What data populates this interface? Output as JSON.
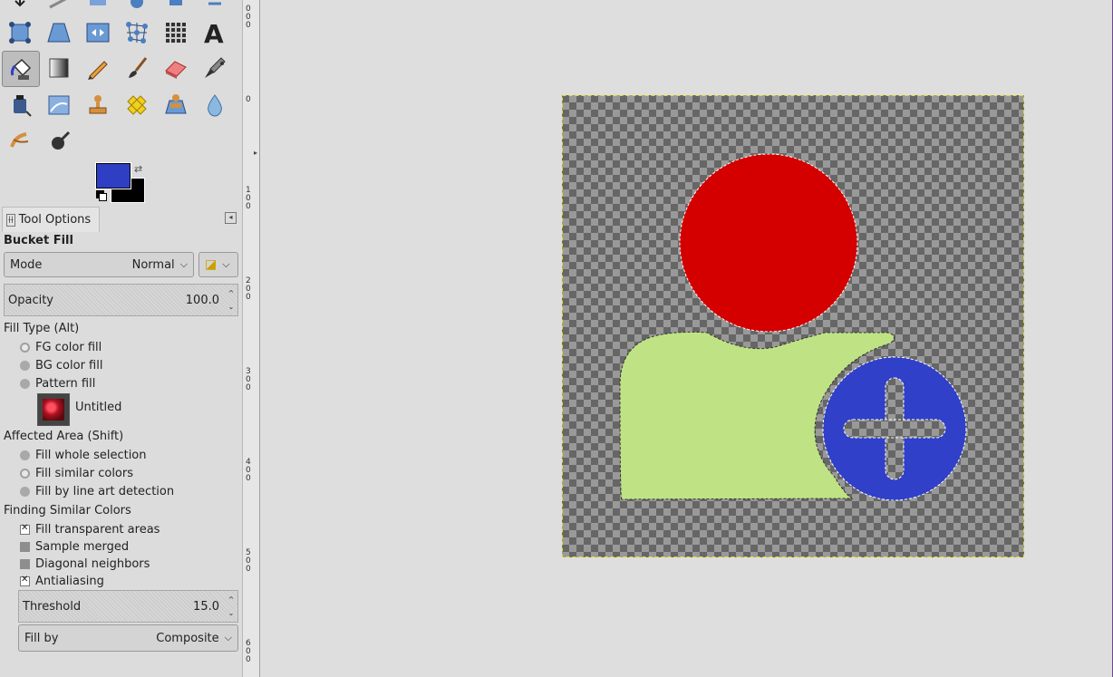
{
  "toolbox": {
    "tools": [
      {
        "icon": "unified-transform-icon"
      },
      {
        "icon": "perspective-icon"
      },
      {
        "icon": "flip-icon"
      },
      {
        "icon": "cage-transform-icon"
      },
      {
        "icon": "warp-transform-icon"
      },
      {
        "icon": "text-icon",
        "glyph": "A"
      },
      {
        "icon": "bucket-fill-icon",
        "active": true
      },
      {
        "icon": "gradient-icon"
      },
      {
        "icon": "pencil-icon"
      },
      {
        "icon": "paintbrush-icon"
      },
      {
        "icon": "eraser-icon"
      },
      {
        "icon": "airbrush-icon"
      },
      {
        "icon": "ink-icon"
      },
      {
        "icon": "mypaint-brush-icon"
      },
      {
        "icon": "clone-icon"
      },
      {
        "icon": "heal-icon"
      },
      {
        "icon": "perspective-clone-icon"
      },
      {
        "icon": "blur-icon"
      },
      {
        "icon": "smudge-icon"
      },
      {
        "icon": "dodge-burn-icon"
      }
    ],
    "fg_color": "#2f3fc4",
    "bg_color": "#000000"
  },
  "tool_options": {
    "tab_label": "Tool Options",
    "title": "Bucket Fill",
    "mode_label": "Mode",
    "mode_value": "Normal",
    "opacity_label": "Opacity",
    "opacity_value": "100.0",
    "fill_type_label": "Fill Type  (Alt)",
    "fill_type_options": [
      "FG color fill",
      "BG color fill",
      "Pattern fill"
    ],
    "fill_type_selected": "FG color fill",
    "pattern_name": "Untitled",
    "affected_area_label": "Affected Area  (Shift)",
    "affected_area_options": [
      "Fill whole selection",
      "Fill similar colors",
      "Fill by line art detection"
    ],
    "affected_area_selected": "Fill similar colors",
    "finding_label": "Finding Similar Colors",
    "checks": [
      {
        "label": "Fill transparent areas",
        "checked": true
      },
      {
        "label": "Sample merged",
        "checked": false
      },
      {
        "label": "Diagonal neighbors",
        "checked": false
      },
      {
        "label": "Antialiasing",
        "checked": true
      }
    ],
    "threshold_label": "Threshold",
    "threshold_value": "15.0",
    "fill_by_label": "Fill by",
    "fill_by_value": "Composite"
  },
  "ruler": {
    "ticks": [
      "0",
      "0",
      "100",
      "200",
      "300",
      "400",
      "500",
      "600"
    ]
  },
  "image": {
    "head_color": "#d40000",
    "body_color": "#bfe384",
    "badge_color": "#3040c8"
  }
}
